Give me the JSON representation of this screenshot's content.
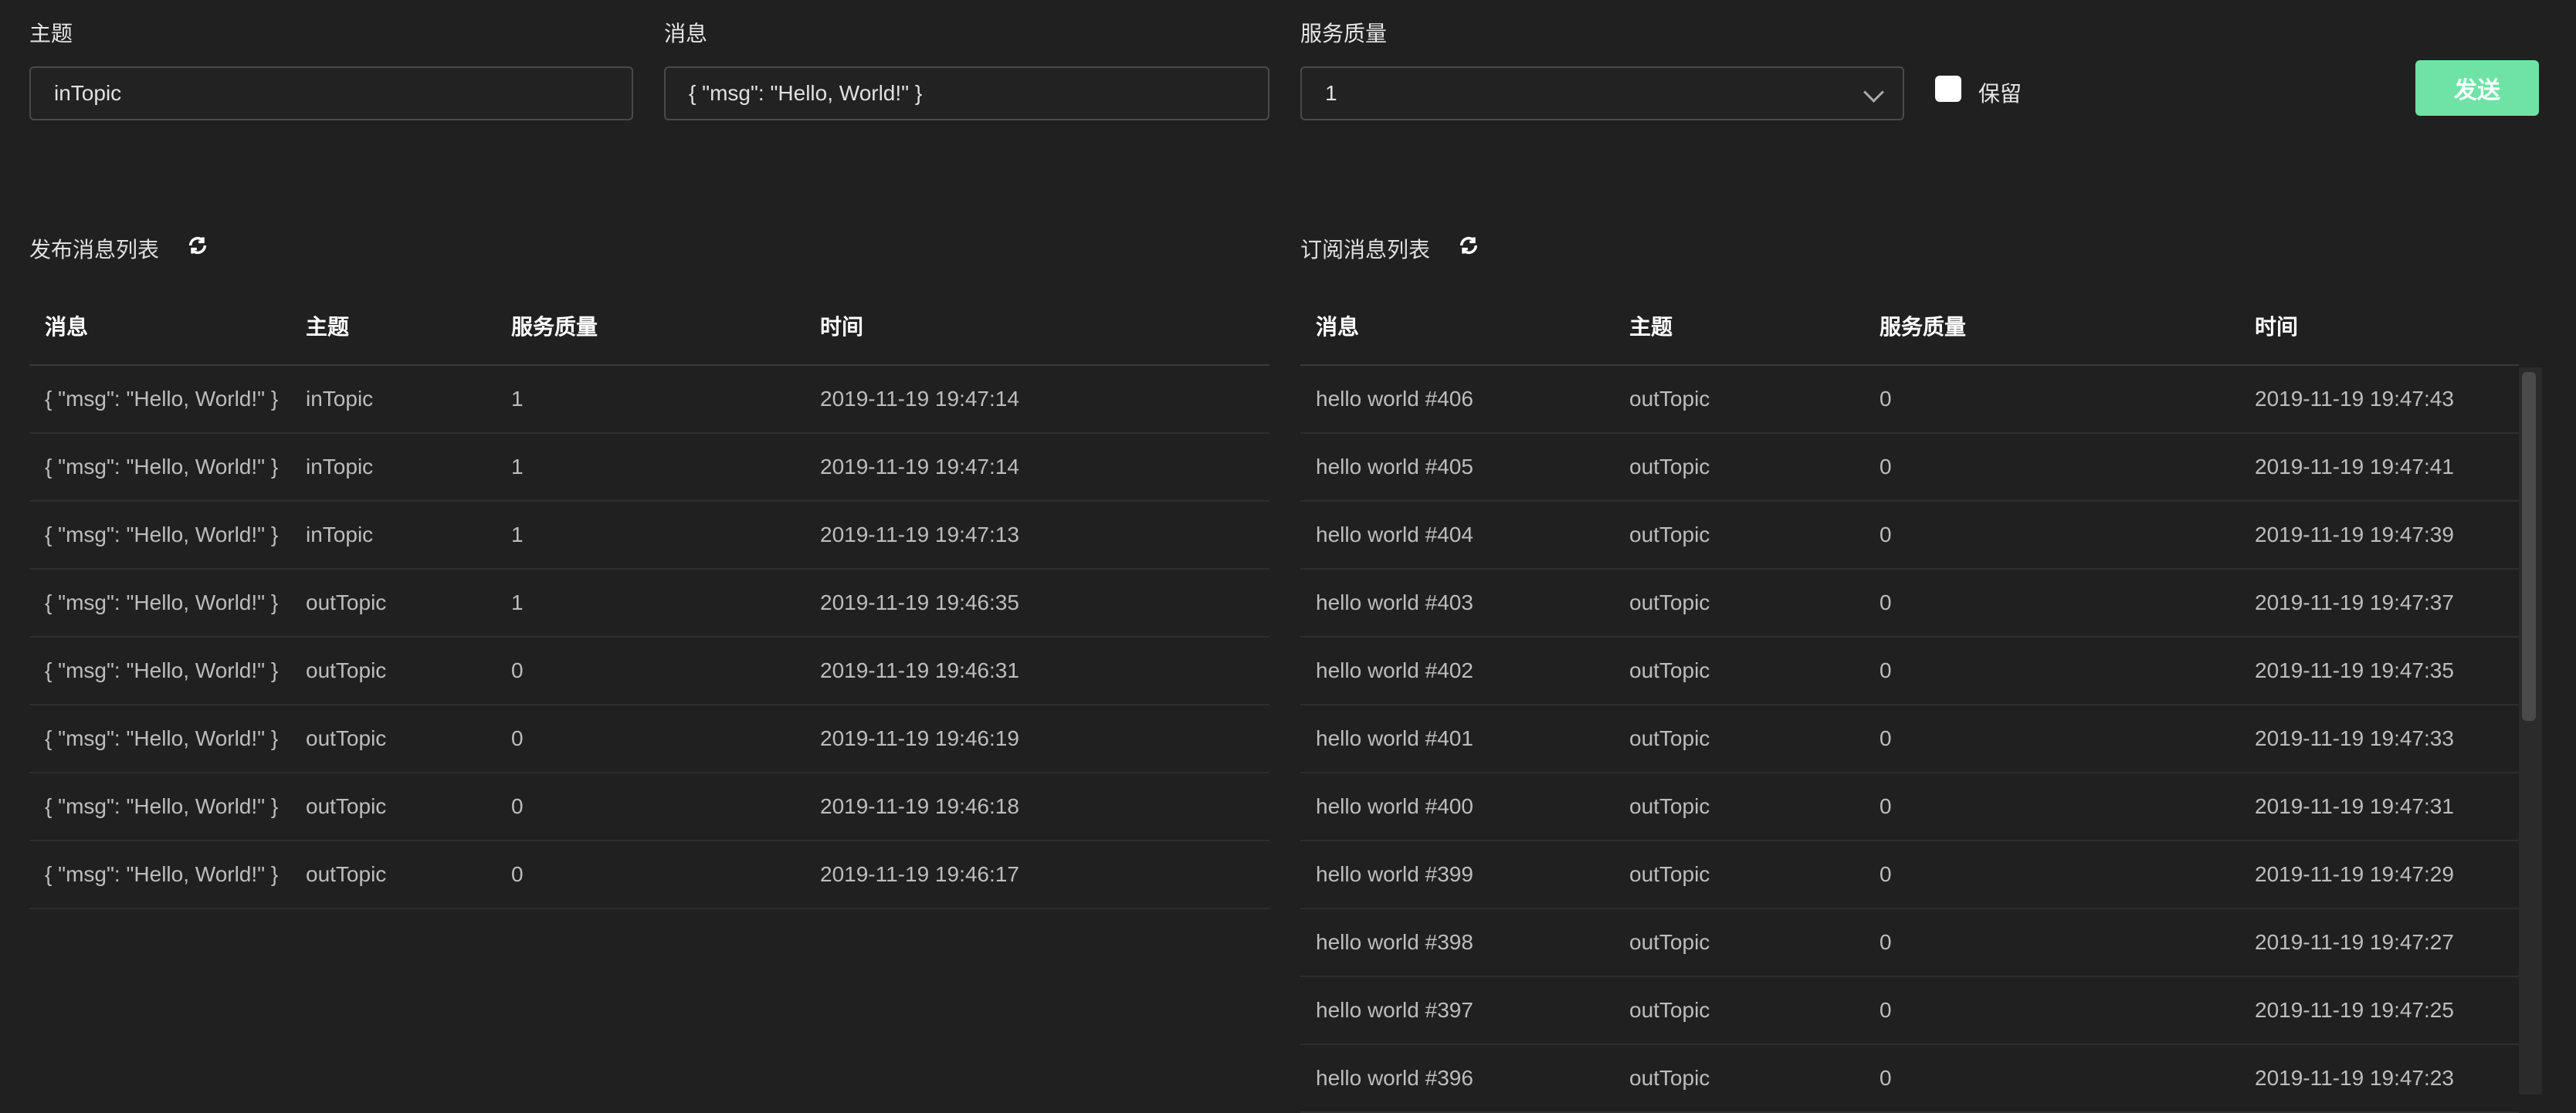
{
  "form": {
    "topic_label": "主题",
    "topic_value": "inTopic",
    "message_label": "消息",
    "message_value": "{ \"msg\": \"Hello, World!\" }",
    "qos_label": "服务质量",
    "qos_value": "1",
    "retain_label": "保留",
    "send_label": "发送"
  },
  "published": {
    "title": "发布消息列表",
    "headers": [
      "消息",
      "主题",
      "服务质量",
      "时间"
    ],
    "rows": [
      [
        "{ \"msg\": \"Hello, World!\" }",
        "inTopic",
        "1",
        "2019-11-19 19:47:14"
      ],
      [
        "{ \"msg\": \"Hello, World!\" }",
        "inTopic",
        "1",
        "2019-11-19 19:47:14"
      ],
      [
        "{ \"msg\": \"Hello, World!\" }",
        "inTopic",
        "1",
        "2019-11-19 19:47:13"
      ],
      [
        "{ \"msg\": \"Hello, World!\" }",
        "outTopic",
        "1",
        "2019-11-19 19:46:35"
      ],
      [
        "{ \"msg\": \"Hello, World!\" }",
        "outTopic",
        "0",
        "2019-11-19 19:46:31"
      ],
      [
        "{ \"msg\": \"Hello, World!\" }",
        "outTopic",
        "0",
        "2019-11-19 19:46:19"
      ],
      [
        "{ \"msg\": \"Hello, World!\" }",
        "outTopic",
        "0",
        "2019-11-19 19:46:18"
      ],
      [
        "{ \"msg\": \"Hello, World!\" }",
        "outTopic",
        "0",
        "2019-11-19 19:46:17"
      ]
    ]
  },
  "subscribed": {
    "title": "订阅消息列表",
    "headers": [
      "消息",
      "主题",
      "服务质量",
      "时间"
    ],
    "rows": [
      [
        "hello world #406",
        "outTopic",
        "0",
        "2019-11-19 19:47:43"
      ],
      [
        "hello world #405",
        "outTopic",
        "0",
        "2019-11-19 19:47:41"
      ],
      [
        "hello world #404",
        "outTopic",
        "0",
        "2019-11-19 19:47:39"
      ],
      [
        "hello world #403",
        "outTopic",
        "0",
        "2019-11-19 19:47:37"
      ],
      [
        "hello world #402",
        "outTopic",
        "0",
        "2019-11-19 19:47:35"
      ],
      [
        "hello world #401",
        "outTopic",
        "0",
        "2019-11-19 19:47:33"
      ],
      [
        "hello world #400",
        "outTopic",
        "0",
        "2019-11-19 19:47:31"
      ],
      [
        "hello world #399",
        "outTopic",
        "0",
        "2019-11-19 19:47:29"
      ],
      [
        "hello world #398",
        "outTopic",
        "0",
        "2019-11-19 19:47:27"
      ],
      [
        "hello world #397",
        "outTopic",
        "0",
        "2019-11-19 19:47:25"
      ],
      [
        "hello world #396",
        "outTopic",
        "0",
        "2019-11-19 19:47:23"
      ]
    ]
  },
  "icons": {
    "refresh": "refresh-icon",
    "dropdown": "chevron-down-icon"
  },
  "colors": {
    "accent": "#6ee3a5",
    "background": "#202020"
  }
}
